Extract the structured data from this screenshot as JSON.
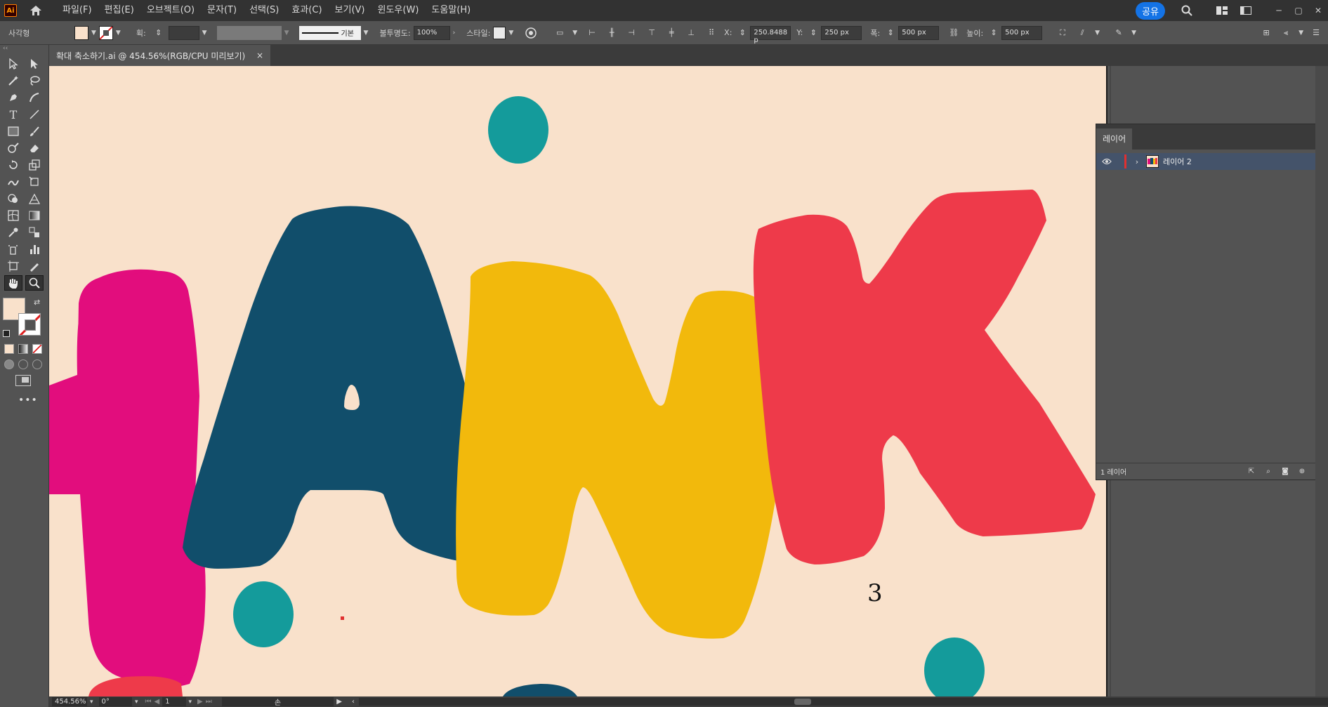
{
  "app": {
    "logo": "Ai",
    "title": "Adobe Illustrator"
  },
  "menu": [
    "파일(F)",
    "편집(E)",
    "오브젝트(O)",
    "문자(T)",
    "선택(S)",
    "효과(C)",
    "보기(V)",
    "윈도우(W)",
    "도움말(H)"
  ],
  "menubar_right": {
    "share": "공유"
  },
  "control": {
    "shape_label": "사각형",
    "stroke_label": "획:",
    "stroke_profile": "기본",
    "opacity_label": "불투명도:",
    "opacity_value": "100%",
    "style_label": "스타일:",
    "x_label": "X:",
    "x_value": "250.8488 p",
    "y_label": "Y:",
    "y_value": "250 px",
    "w_label": "폭:",
    "w_value": "500 px",
    "h_label": "높이:",
    "h_value": "500 px"
  },
  "document": {
    "tab_title": "확대 축소하기.ai @ 454.56%(RGB/CPU 미리보기)",
    "close": "×"
  },
  "artboard": {
    "number_label": "3",
    "bg_color": "#f9e1cb"
  },
  "colors": {
    "pink": "#e20d7d",
    "navy": "#114e6b",
    "yellow": "#f2b90c",
    "red": "#ee3a4a",
    "teal": "#149b9b",
    "fill": "#f9e1cb",
    "accent": "#1473e6"
  },
  "layers": {
    "tab": "레이어",
    "items": [
      {
        "name": "레이어 2",
        "visible": true
      }
    ],
    "footer_count": "1 레이어"
  },
  "status": {
    "zoom": "454.56%",
    "rotation": "0°",
    "artboard_index": "1",
    "tool": "손"
  }
}
